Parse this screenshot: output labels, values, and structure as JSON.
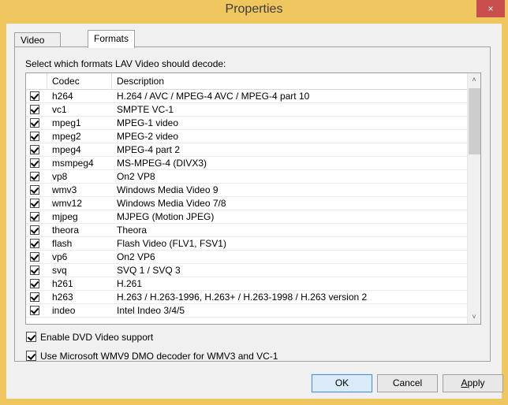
{
  "window": {
    "title": "Properties",
    "close_label": "×",
    "titlebar_color": "#efc75e",
    "close_button_color": "#c94f4f",
    "client_color": "#f0f0f0"
  },
  "tabs": [
    {
      "label": "Video Settings",
      "active": false
    },
    {
      "label": "Formats",
      "active": true
    }
  ],
  "panel": {
    "instruction": "Select which formats LAV Video should decode:"
  },
  "list": {
    "columns": [
      "",
      "Codec",
      "Description"
    ],
    "rows": [
      {
        "checked": true,
        "codec": "h264",
        "description": "H.264 / AVC / MPEG-4 AVC / MPEG-4 part 10"
      },
      {
        "checked": true,
        "codec": "vc1",
        "description": "SMPTE VC-1"
      },
      {
        "checked": true,
        "codec": "mpeg1",
        "description": "MPEG-1 video"
      },
      {
        "checked": true,
        "codec": "mpeg2",
        "description": "MPEG-2 video"
      },
      {
        "checked": true,
        "codec": "mpeg4",
        "description": "MPEG-4 part 2"
      },
      {
        "checked": true,
        "codec": "msmpeg4",
        "description": "MS-MPEG-4 (DIVX3)"
      },
      {
        "checked": true,
        "codec": "vp8",
        "description": "On2 VP8"
      },
      {
        "checked": true,
        "codec": "wmv3",
        "description": "Windows Media Video 9"
      },
      {
        "checked": true,
        "codec": "wmv12",
        "description": "Windows Media Video 7/8"
      },
      {
        "checked": true,
        "codec": "mjpeg",
        "description": "MJPEG (Motion JPEG)"
      },
      {
        "checked": true,
        "codec": "theora",
        "description": "Theora"
      },
      {
        "checked": true,
        "codec": "flash",
        "description": "Flash Video (FLV1, FSV1)"
      },
      {
        "checked": true,
        "codec": "vp6",
        "description": "On2 VP6"
      },
      {
        "checked": true,
        "codec": "svq",
        "description": "SVQ 1 / SVQ 3"
      },
      {
        "checked": true,
        "codec": "h261",
        "description": "H.261"
      },
      {
        "checked": true,
        "codec": "h263",
        "description": "H.263 / H.263-1996, H.263+ / H.263-1998 / H.263 version 2"
      },
      {
        "checked": true,
        "codec": "indeo",
        "description": "Intel Indeo 3/4/5"
      }
    ],
    "scrollbar": {
      "up_arrow": "˄",
      "down_arrow": "˅"
    }
  },
  "options": [
    {
      "checked": true,
      "label": "Enable DVD Video support"
    },
    {
      "checked": true,
      "label": "Use Microsoft WMV9 DMO decoder for WMV3 and VC-1"
    }
  ],
  "buttons": {
    "ok": "OK",
    "cancel": "Cancel",
    "apply_mnemonic": "A",
    "apply_rest": "pply"
  }
}
